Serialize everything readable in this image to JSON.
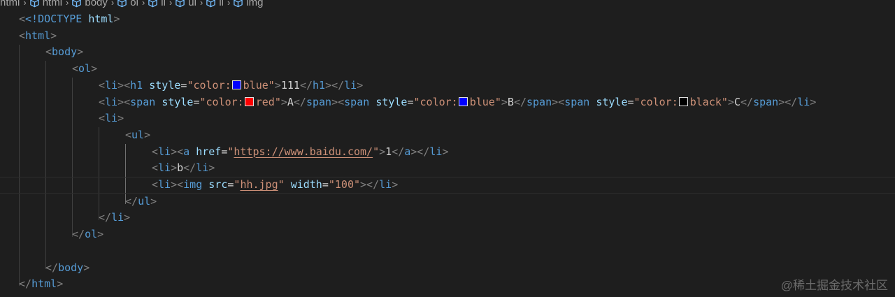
{
  "breadcrumb": {
    "root": "html",
    "items": [
      "html",
      "body",
      "ol",
      "li",
      "ul",
      "li",
      "img"
    ]
  },
  "code": {
    "doctype_open": "<!DOCTYPE",
    "doctype_name": "html",
    "html": "html",
    "body": "body",
    "ol": "ol",
    "li": "li",
    "ul": "ul",
    "h1": "h1",
    "span": "span",
    "a": "a",
    "img": "img",
    "attr_style": "style",
    "attr_href": "href",
    "attr_src": "src",
    "attr_width": "width",
    "color_prefix": "color:",
    "color_blue": "blue",
    "color_red": "red",
    "color_black": "black",
    "text_111": "111",
    "text_A": "A",
    "text_B": "B",
    "text_C": "C",
    "text_1": "1",
    "text_b": "b",
    "href_value": "https://www.baidu.com/",
    "src_value": "hh.jpg",
    "width_value": "100"
  },
  "swatch_colors": {
    "blue": "#0000ff",
    "red": "#ff0000",
    "black": "#000000"
  },
  "watermark": "@稀土掘金技术社区"
}
